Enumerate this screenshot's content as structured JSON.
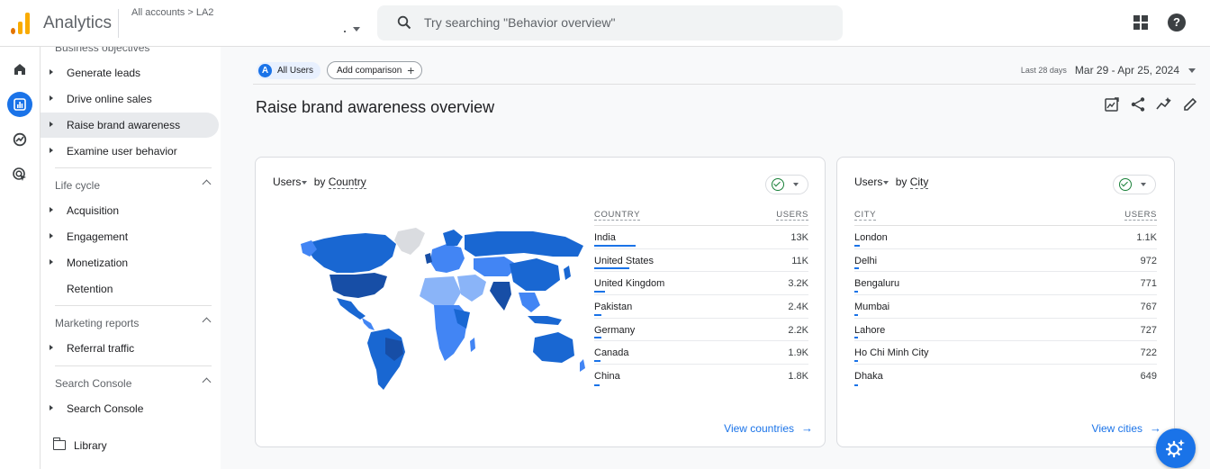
{
  "header": {
    "app_title": "Analytics",
    "breadcrumb": "All accounts > LA2",
    "search_placeholder": "Try searching \"Behavior overview\"",
    "help_glyph": "?"
  },
  "icons": {
    "logo": "analytics-logo-icon",
    "search": "search-icon",
    "apps": "apps-grid-icon",
    "help": "help-icon",
    "rail": [
      "home-icon",
      "reports-icon",
      "explore-icon",
      "advertising-icon"
    ],
    "toolbar": [
      "customize-report-icon",
      "share-icon",
      "insights-icon",
      "edit-icon"
    ],
    "fab": "ai-assistant-icon"
  },
  "nav": {
    "partial_section": "Business objectives",
    "business_items": [
      "Generate leads",
      "Drive online sales",
      "Raise brand awareness",
      "Examine user behavior"
    ],
    "active_item": "Raise brand awareness",
    "lifecycle_title": "Life cycle",
    "lifecycle_items": [
      "Acquisition",
      "Engagement",
      "Monetization"
    ],
    "retention": "Retention",
    "marketing_title": "Marketing reports",
    "marketing_items": [
      "Referral traffic"
    ],
    "search_console_title": "Search Console",
    "search_console_items": [
      "Search Console"
    ],
    "library": "Library"
  },
  "main": {
    "segment_badge": "A",
    "segment_label": "All Users",
    "add_comparison": "Add comparison",
    "add_plus": "+",
    "date_range_label": "Last 28 days",
    "date_range": "Mar 29 - Apr 25, 2024",
    "page_title": "Raise brand awareness overview"
  },
  "country_card": {
    "metric": "Users",
    "by": "by",
    "dimension": "Country",
    "col_dim": "COUNTRY",
    "col_metric": "USERS",
    "rows": [
      {
        "name": "India",
        "value": "13K",
        "share": 1.0
      },
      {
        "name": "United States",
        "value": "11K",
        "share": 0.85
      },
      {
        "name": "United Kingdom",
        "value": "3.2K",
        "share": 0.25
      },
      {
        "name": "Pakistan",
        "value": "2.4K",
        "share": 0.18
      },
      {
        "name": "Germany",
        "value": "2.2K",
        "share": 0.17
      },
      {
        "name": "Canada",
        "value": "1.9K",
        "share": 0.15
      },
      {
        "name": "China",
        "value": "1.8K",
        "share": 0.14
      }
    ],
    "view_link": "View countries",
    "map_colors": {
      "high": "#174ea6",
      "mid": "#1967d2",
      "low": "#4285f4",
      "lower": "#8ab4f8",
      "none": "#dadce0"
    }
  },
  "city_card": {
    "metric": "Users",
    "by": "by",
    "dimension": "City",
    "col_dim": "CITY",
    "col_metric": "USERS",
    "rows": [
      {
        "name": "London",
        "value": "1.1K",
        "share": 0.12
      },
      {
        "name": "Delhi",
        "value": "972",
        "share": 0.1
      },
      {
        "name": "Bengaluru",
        "value": "771",
        "share": 0.08
      },
      {
        "name": "Mumbai",
        "value": "767",
        "share": 0.08
      },
      {
        "name": "Lahore",
        "value": "727",
        "share": 0.07
      },
      {
        "name": "Ho Chi Minh City",
        "value": "722",
        "share": 0.07
      },
      {
        "name": "Dhaka",
        "value": "649",
        "share": 0.06
      }
    ],
    "view_link": "View cities"
  },
  "colors": {
    "accent": "#1a73e8",
    "success": "#188038",
    "logo_orange": "#f9ab00"
  }
}
